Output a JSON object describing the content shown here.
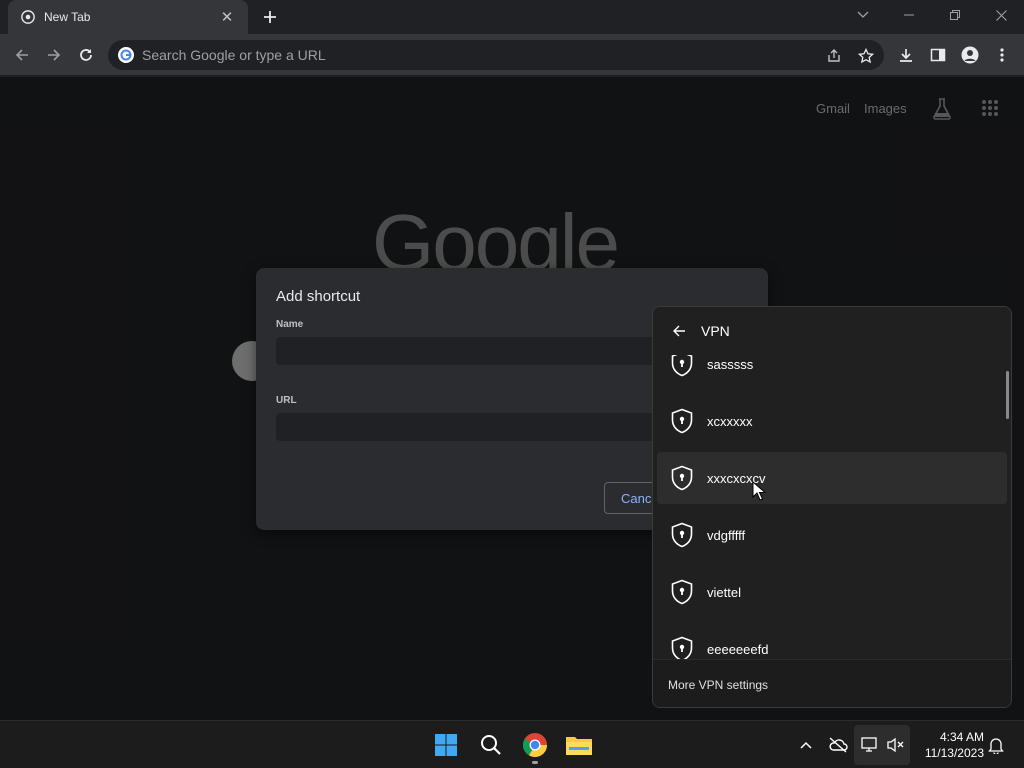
{
  "browser": {
    "tab_title": "New Tab",
    "omnibox_placeholder": "Search Google or type a URL"
  },
  "ntp": {
    "gmail_link": "Gmail",
    "images_link": "Images",
    "logo_text": "Google"
  },
  "dialog": {
    "title": "Add shortcut",
    "name_label": "Name",
    "name_value": "",
    "url_label": "URL",
    "url_value": "",
    "cancel_label": "Cance"
  },
  "vpn_panel": {
    "title": "VPN",
    "items": [
      {
        "name": "sasssss"
      },
      {
        "name": "xcxxxxx"
      },
      {
        "name": "xxxcxcxcv",
        "hovered": true
      },
      {
        "name": "vdgfffff"
      },
      {
        "name": "viettel"
      },
      {
        "name": "eeeeeeefd"
      }
    ],
    "more_settings": "More VPN settings"
  },
  "taskbar": {
    "time": "4:34 AM",
    "date": "11/13/2023",
    "apps": [
      "windows-start-icon",
      "search-icon",
      "chrome-icon",
      "file-explorer-icon"
    ]
  }
}
